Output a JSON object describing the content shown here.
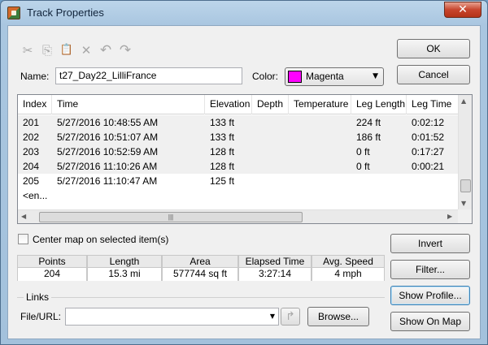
{
  "window": {
    "title": "Track Properties",
    "close_glyph": "✕"
  },
  "toolbar": {
    "cut": "✂",
    "copy": "⎘",
    "paste": "📋",
    "delete": "✕",
    "undo": "↶",
    "redo": "↷"
  },
  "name": {
    "label": "Name:",
    "value": "t27_Day22_LilliFrance"
  },
  "color": {
    "label": "Color:",
    "value": "Magenta",
    "swatch": "#ff00ff"
  },
  "buttons": {
    "ok": "OK",
    "cancel": "Cancel",
    "invert": "Invert",
    "filter": "Filter...",
    "show_profile": "Show Profile...",
    "show_on_map": "Show On Map",
    "browse": "Browse..."
  },
  "table": {
    "columns": [
      "Index",
      "Time",
      "Elevation",
      "Depth",
      "Temperature",
      "Leg Length",
      "Leg Time"
    ],
    "rows": [
      [
        "201",
        "5/27/2016 10:48:55 AM",
        "133 ft",
        "",
        "",
        "224 ft",
        "0:02:12"
      ],
      [
        "202",
        "5/27/2016 10:51:07 AM",
        "133 ft",
        "",
        "",
        "186 ft",
        "0:01:52"
      ],
      [
        "203",
        "5/27/2016 10:52:59 AM",
        "128 ft",
        "",
        "",
        "0 ft",
        "0:17:27"
      ],
      [
        "204",
        "5/27/2016 11:10:26 AM",
        "128 ft",
        "",
        "",
        "0 ft",
        "0:00:21"
      ],
      [
        "205",
        "5/27/2016 11:10:47 AM",
        "125 ft",
        "",
        "",
        "",
        ""
      ]
    ],
    "end_marker": "<en..."
  },
  "center_map": {
    "label": "Center map on selected item(s)",
    "checked": false
  },
  "stats": [
    {
      "label": "Points",
      "value": "204"
    },
    {
      "label": "Length",
      "value": "15.3 mi"
    },
    {
      "label": "Area",
      "value": "577744 sq ft"
    },
    {
      "label": "Elapsed Time",
      "value": "3:27:14"
    },
    {
      "label": "Avg. Speed",
      "value": "4 mph"
    }
  ],
  "links": {
    "title": "Links",
    "file_url_label": "File/URL:",
    "file_url_value": "",
    "go_glyph": "↱"
  }
}
